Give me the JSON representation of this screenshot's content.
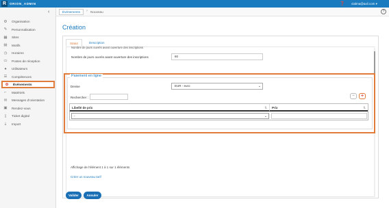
{
  "header": {
    "logo_letter": "R",
    "app_name": "ORION_ADMIN",
    "help_icon": "question-icon",
    "user_label": "ctalma@axil.com ▾"
  },
  "sidebar": {
    "collapse_glyph": "‹",
    "items": [
      {
        "label": "Organisation",
        "icon": "settings-icon",
        "glyph": "⚙",
        "active": false
      },
      {
        "label": "Personnalisation",
        "icon": "brush-icon",
        "glyph": "✎",
        "active": false
      },
      {
        "label": "Sites",
        "icon": "building-icon",
        "glyph": "▦",
        "active": false
      },
      {
        "label": "Motifs",
        "icon": "document-icon",
        "glyph": "▤",
        "active": false
      },
      {
        "label": "Horaires",
        "icon": "clock-icon",
        "glyph": "◷",
        "active": false
      },
      {
        "label": "Postes de réception",
        "icon": "desk-icon",
        "glyph": "▭",
        "active": false
      },
      {
        "label": "Utilisateurs",
        "icon": "user-icon",
        "glyph": "●",
        "active": false
      },
      {
        "label": "Compétences",
        "icon": "skills-icon",
        "glyph": "☰",
        "active": false
      },
      {
        "label": "Événements",
        "icon": "event-icon",
        "glyph": "✿",
        "active": true
      },
      {
        "label": "Matériels",
        "icon": "equipment-icon",
        "glyph": "⌐",
        "active": false
      },
      {
        "label": "Messages d'orientation",
        "icon": "message-icon",
        "glyph": "✉",
        "active": false
      },
      {
        "label": "Rendez-vous",
        "icon": "calendar-icon",
        "glyph": "▣",
        "active": false
      },
      {
        "label": "Ticket digital",
        "icon": "ticket-icon",
        "glyph": "▯",
        "active": false
      },
      {
        "label": "Import",
        "icon": "import-icon",
        "glyph": "⤓",
        "active": false
      }
    ]
  },
  "breadcrumb": {
    "parent": "Événements",
    "separator": "›",
    "current": "Nouveau",
    "help_glyph": "?"
  },
  "page": {
    "title": "Création",
    "tabs": [
      {
        "label": "Statut",
        "active": true
      },
      {
        "label": "Description",
        "active": false
      }
    ]
  },
  "form": {
    "cut_label": "Nombre de jours ouvrés avant ouverture des inscriptions",
    "days_label": "Nombre de jours ouvrés avant ouverture des inscriptions",
    "days_value": "60"
  },
  "payment": {
    "legend": "Paiement en ligne",
    "devise_label": "Devise",
    "devise_value": "EUR - euro",
    "search_label": "Rechercher :",
    "search_value": "",
    "minus_label": "−",
    "plus_label": "+",
    "columns": [
      "Libellé de prix",
      "Prix"
    ],
    "sort_glyph": "⇅",
    "row_select_value": "-",
    "row_price_value": ""
  },
  "table_info": "Affichage de l'élément 1 à 1 sur 1 éléments",
  "new_rate_link": "Créer un nouveau tarif",
  "actions": {
    "save_label": "Valider",
    "cancel_label": "Annuler"
  },
  "colors": {
    "brand": "#1a7bbf",
    "highlight": "#e07b39"
  }
}
